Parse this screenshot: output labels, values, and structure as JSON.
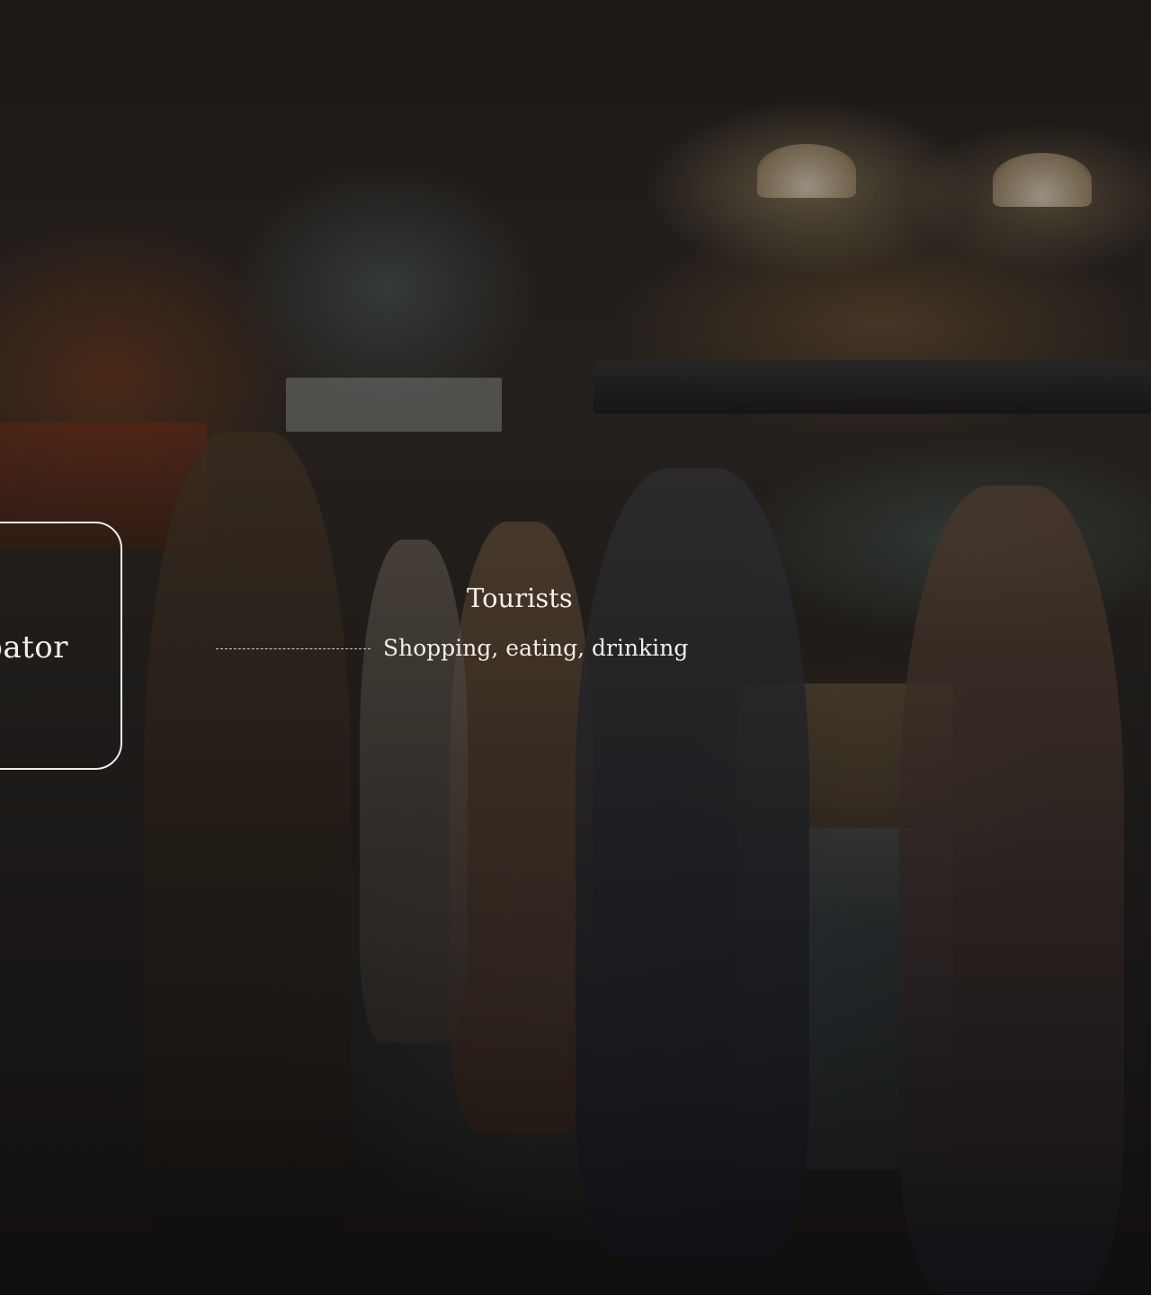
{
  "card": {
    "title": "bator"
  },
  "node": {
    "title": "Tourists",
    "subtitle": "Shopping, eating, drinking"
  },
  "colors": {
    "text": "#f3efe8",
    "card_border": "#ffffff"
  }
}
